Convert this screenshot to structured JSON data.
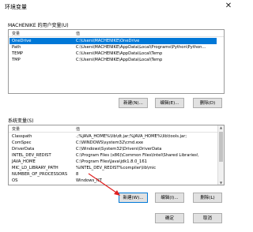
{
  "window": {
    "title": "环境变量",
    "close_glyph": "✕"
  },
  "user_section": {
    "label": "MACHENIKE 的用户变量(U)",
    "columns": [
      "变量",
      "值"
    ],
    "rows": [
      {
        "name": "OneDrive",
        "value": "C:\\Users\\MACHENIKE\\OneDrive",
        "selected": true
      },
      {
        "name": "Path",
        "value": "C:\\Users\\MACHENIKE\\AppData\\Local\\Programs\\Python\\Python...",
        "selected": false
      },
      {
        "name": "TEMP",
        "value": "C:\\Users\\MACHENIKE\\AppData\\Local\\Temp",
        "selected": false
      },
      {
        "name": "TMP",
        "value": "C:\\Users\\MACHENIKE\\AppData\\Local\\Temp",
        "selected": false
      }
    ],
    "buttons": {
      "new": "新建(N)...",
      "edit": "编辑(E)...",
      "delete": "删除(D)"
    }
  },
  "system_section": {
    "label": "系统变量(S)",
    "columns": [
      "变量",
      "值"
    ],
    "rows": [
      {
        "name": "Classpath",
        "value": ".;%JAVA_HOME%\\lib\\dt.jar;%JAVA_HOME%\\lib\\tools.jar;"
      },
      {
        "name": "ComSpec",
        "value": "C:\\WINDOWS\\system32\\cmd.exe"
      },
      {
        "name": "DriverData",
        "value": "C:\\Windows\\System32\\Drivers\\DriverData"
      },
      {
        "name": "INTEL_DEV_REDIST",
        "value": "C:\\Program Files (x86)\\Common Files\\Intel\\Shared Libraries\\"
      },
      {
        "name": "JAVA_HOME",
        "value": "C:\\Program Files\\Java\\jdk1.8.0_161"
      },
      {
        "name": "MIC_LD_LIBRARY_PATH",
        "value": "%INTEL_DEV_REDIST%compiler\\lib\\mic"
      },
      {
        "name": "NUMBER_OF_PROCESSORS",
        "value": "8"
      },
      {
        "name": "OS",
        "value": "Windows_NT"
      }
    ],
    "buttons": {
      "new": "新建(W)...",
      "edit": "编辑(I)...",
      "delete": "删除(L)"
    }
  },
  "footer": {
    "ok": "确定",
    "cancel": "取消"
  },
  "colors": {
    "selection": "#0078d7",
    "arrow": "#e02020"
  }
}
